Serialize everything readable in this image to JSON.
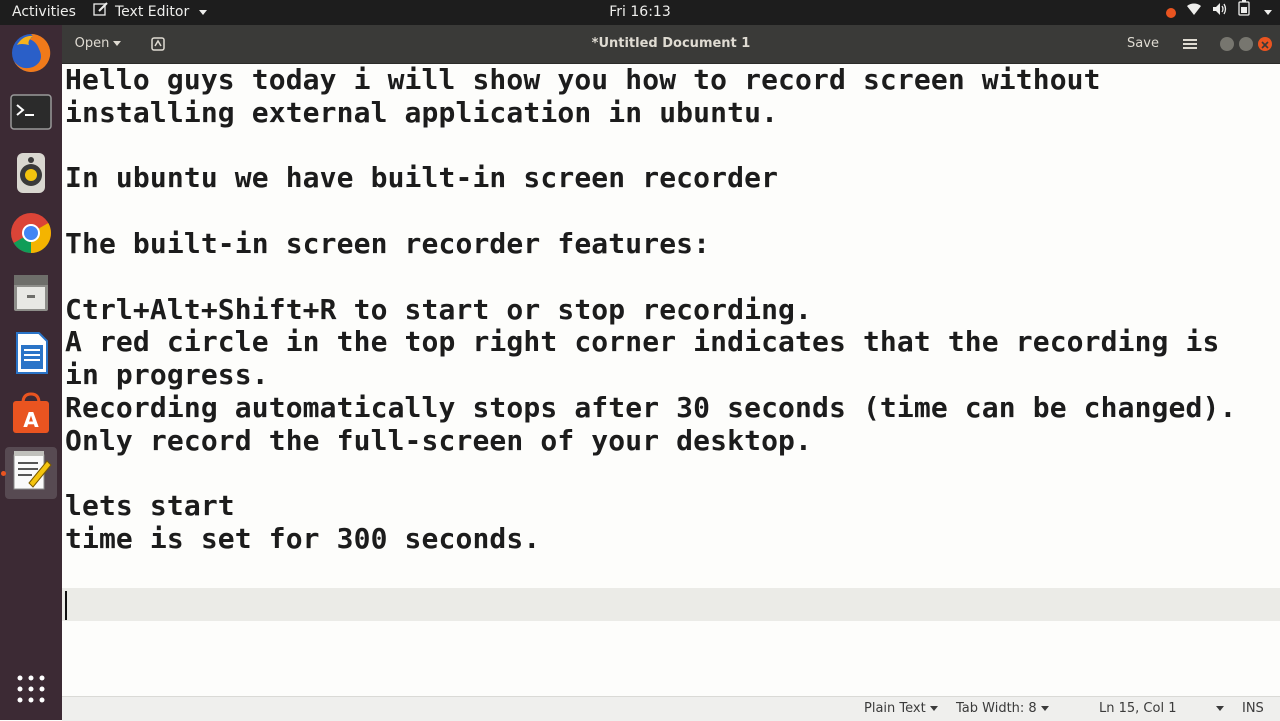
{
  "topbar": {
    "activities": "Activities",
    "app_menu": "Text Editor",
    "clock": "Fri 16:13"
  },
  "dock": {
    "items": [
      "firefox",
      "terminal",
      "rhythmbox",
      "chrome",
      "files",
      "libreoffice-writer",
      "ubuntu-software",
      "text-editor",
      "show-applications"
    ],
    "active": "text-editor"
  },
  "headerbar": {
    "open_label": "Open",
    "title": "*Untitled Document 1",
    "save_label": "Save"
  },
  "editor": {
    "text": "Hello guys today i will show you how to record screen without\ninstalling external application in ubuntu.\n\nIn ubuntu we have built-in screen recorder\n\nThe built-in screen recorder features:\n\nCtrl+Alt+Shift+R to start or stop recording.\nA red circle in the top right corner indicates that the recording is\nin progress.\nRecording automatically stops after 30 seconds (time can be changed).\nOnly record the full-screen of your desktop.\n\nlets start\ntime is set for 300 seconds.\n\n"
  },
  "statusbar": {
    "language": "Plain Text",
    "tab_width": "Tab Width: 8",
    "position": "Ln 15, Col 1",
    "mode": "INS"
  },
  "colors": {
    "accent": "#e95420",
    "dock_bg": "#3c2a34",
    "headerbar_bg": "#3a3a38"
  }
}
